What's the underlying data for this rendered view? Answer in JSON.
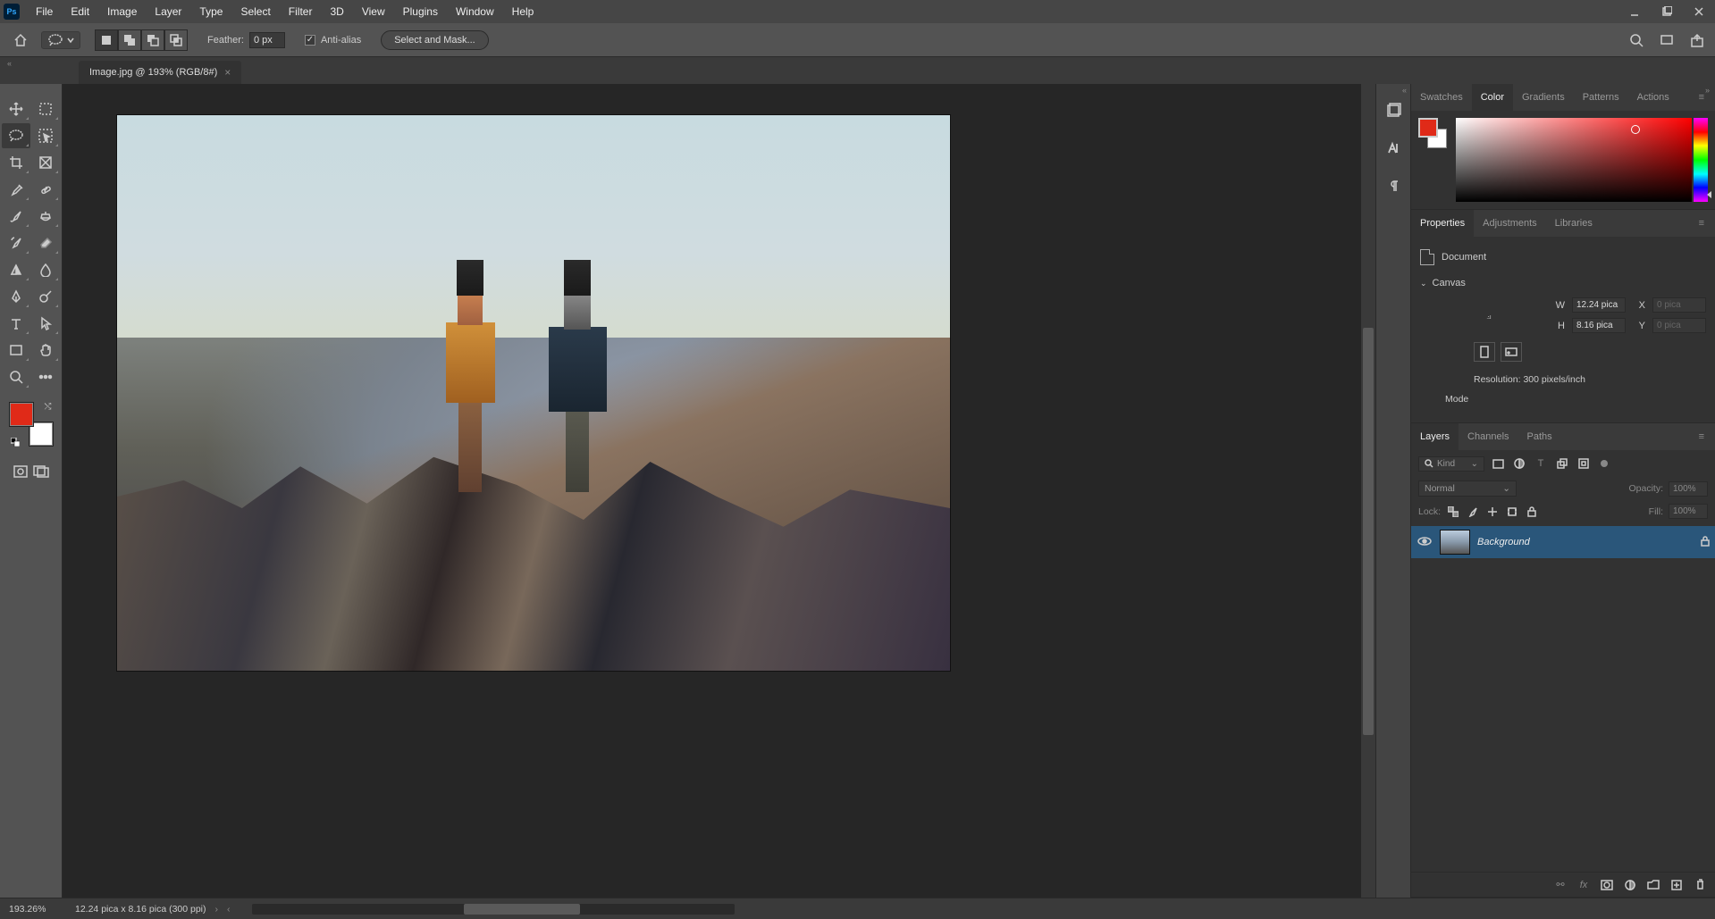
{
  "menubar": {
    "items": [
      "File",
      "Edit",
      "Image",
      "Layer",
      "Type",
      "Select",
      "Filter",
      "3D",
      "View",
      "Plugins",
      "Window",
      "Help"
    ]
  },
  "optionsbar": {
    "feather_label": "Feather:",
    "feather_value": "0 px",
    "antialias_label": "Anti-alias",
    "select_mask_label": "Select and Mask..."
  },
  "document": {
    "tab_title": "Image.jpg @ 193% (RGB/8#)"
  },
  "color_panel": {
    "tabs": [
      "Swatches",
      "Color",
      "Gradients",
      "Patterns",
      "Actions"
    ],
    "active_index": 1,
    "fg_color": "#e02a18"
  },
  "properties_panel": {
    "tabs": [
      "Properties",
      "Adjustments",
      "Libraries"
    ],
    "active_index": 0,
    "doc_type_label": "Document",
    "section_canvas": "Canvas",
    "dims": {
      "W_label": "W",
      "W_value": "12.24 pica",
      "H_label": "H",
      "H_value": "8.16 pica",
      "X_label": "X",
      "X_value": "0 pica",
      "Y_label": "Y",
      "Y_value": "0 pica"
    },
    "resolution_line": "Resolution: 300 pixels/inch",
    "mode_label": "Mode"
  },
  "layers_panel": {
    "tabs": [
      "Layers",
      "Channels",
      "Paths"
    ],
    "active_index": 0,
    "filter_kind": "Kind",
    "blend_mode": "Normal",
    "opacity_label": "Opacity:",
    "opacity_value": "100%",
    "lock_label": "Lock:",
    "fill_label": "Fill:",
    "fill_value": "100%",
    "layers": [
      {
        "name": "Background",
        "visible": true,
        "locked": true
      }
    ]
  },
  "statusbar": {
    "zoom": "193.26%",
    "info": "12.24 pica x 8.16 pica (300 ppi)"
  },
  "colors": {
    "fg": "#e02a18",
    "bg": "#ffffff"
  }
}
